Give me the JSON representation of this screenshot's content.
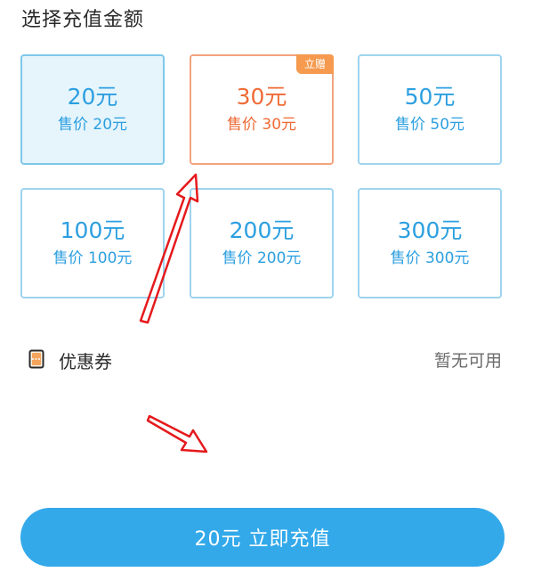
{
  "section_title": "选择充值金额",
  "options": [
    {
      "amount": "20元",
      "price": "售价 20元",
      "selected": true
    },
    {
      "amount": "30元",
      "price": "售价 30元",
      "badge": "立赠"
    },
    {
      "amount": "50元",
      "price": "售价 50元"
    },
    {
      "amount": "100元",
      "price": "售价 100元"
    },
    {
      "amount": "200元",
      "price": "售价 200元"
    },
    {
      "amount": "300元",
      "price": "售价 300元"
    }
  ],
  "coupon": {
    "icon": "ticket-icon",
    "label": "优惠券",
    "status": "暂无可用"
  },
  "cta_label": "20元 立即充值",
  "colors": {
    "accent": "#2c9fe0",
    "promo": "#ef6a35",
    "badge": "#f59a4e",
    "selected_bg": "#e6f5fc",
    "button": "#33a9ea",
    "annotation": "#e5191c"
  },
  "annotations": [
    "arrow-to-30-card",
    "arrow-to-cta-button"
  ]
}
